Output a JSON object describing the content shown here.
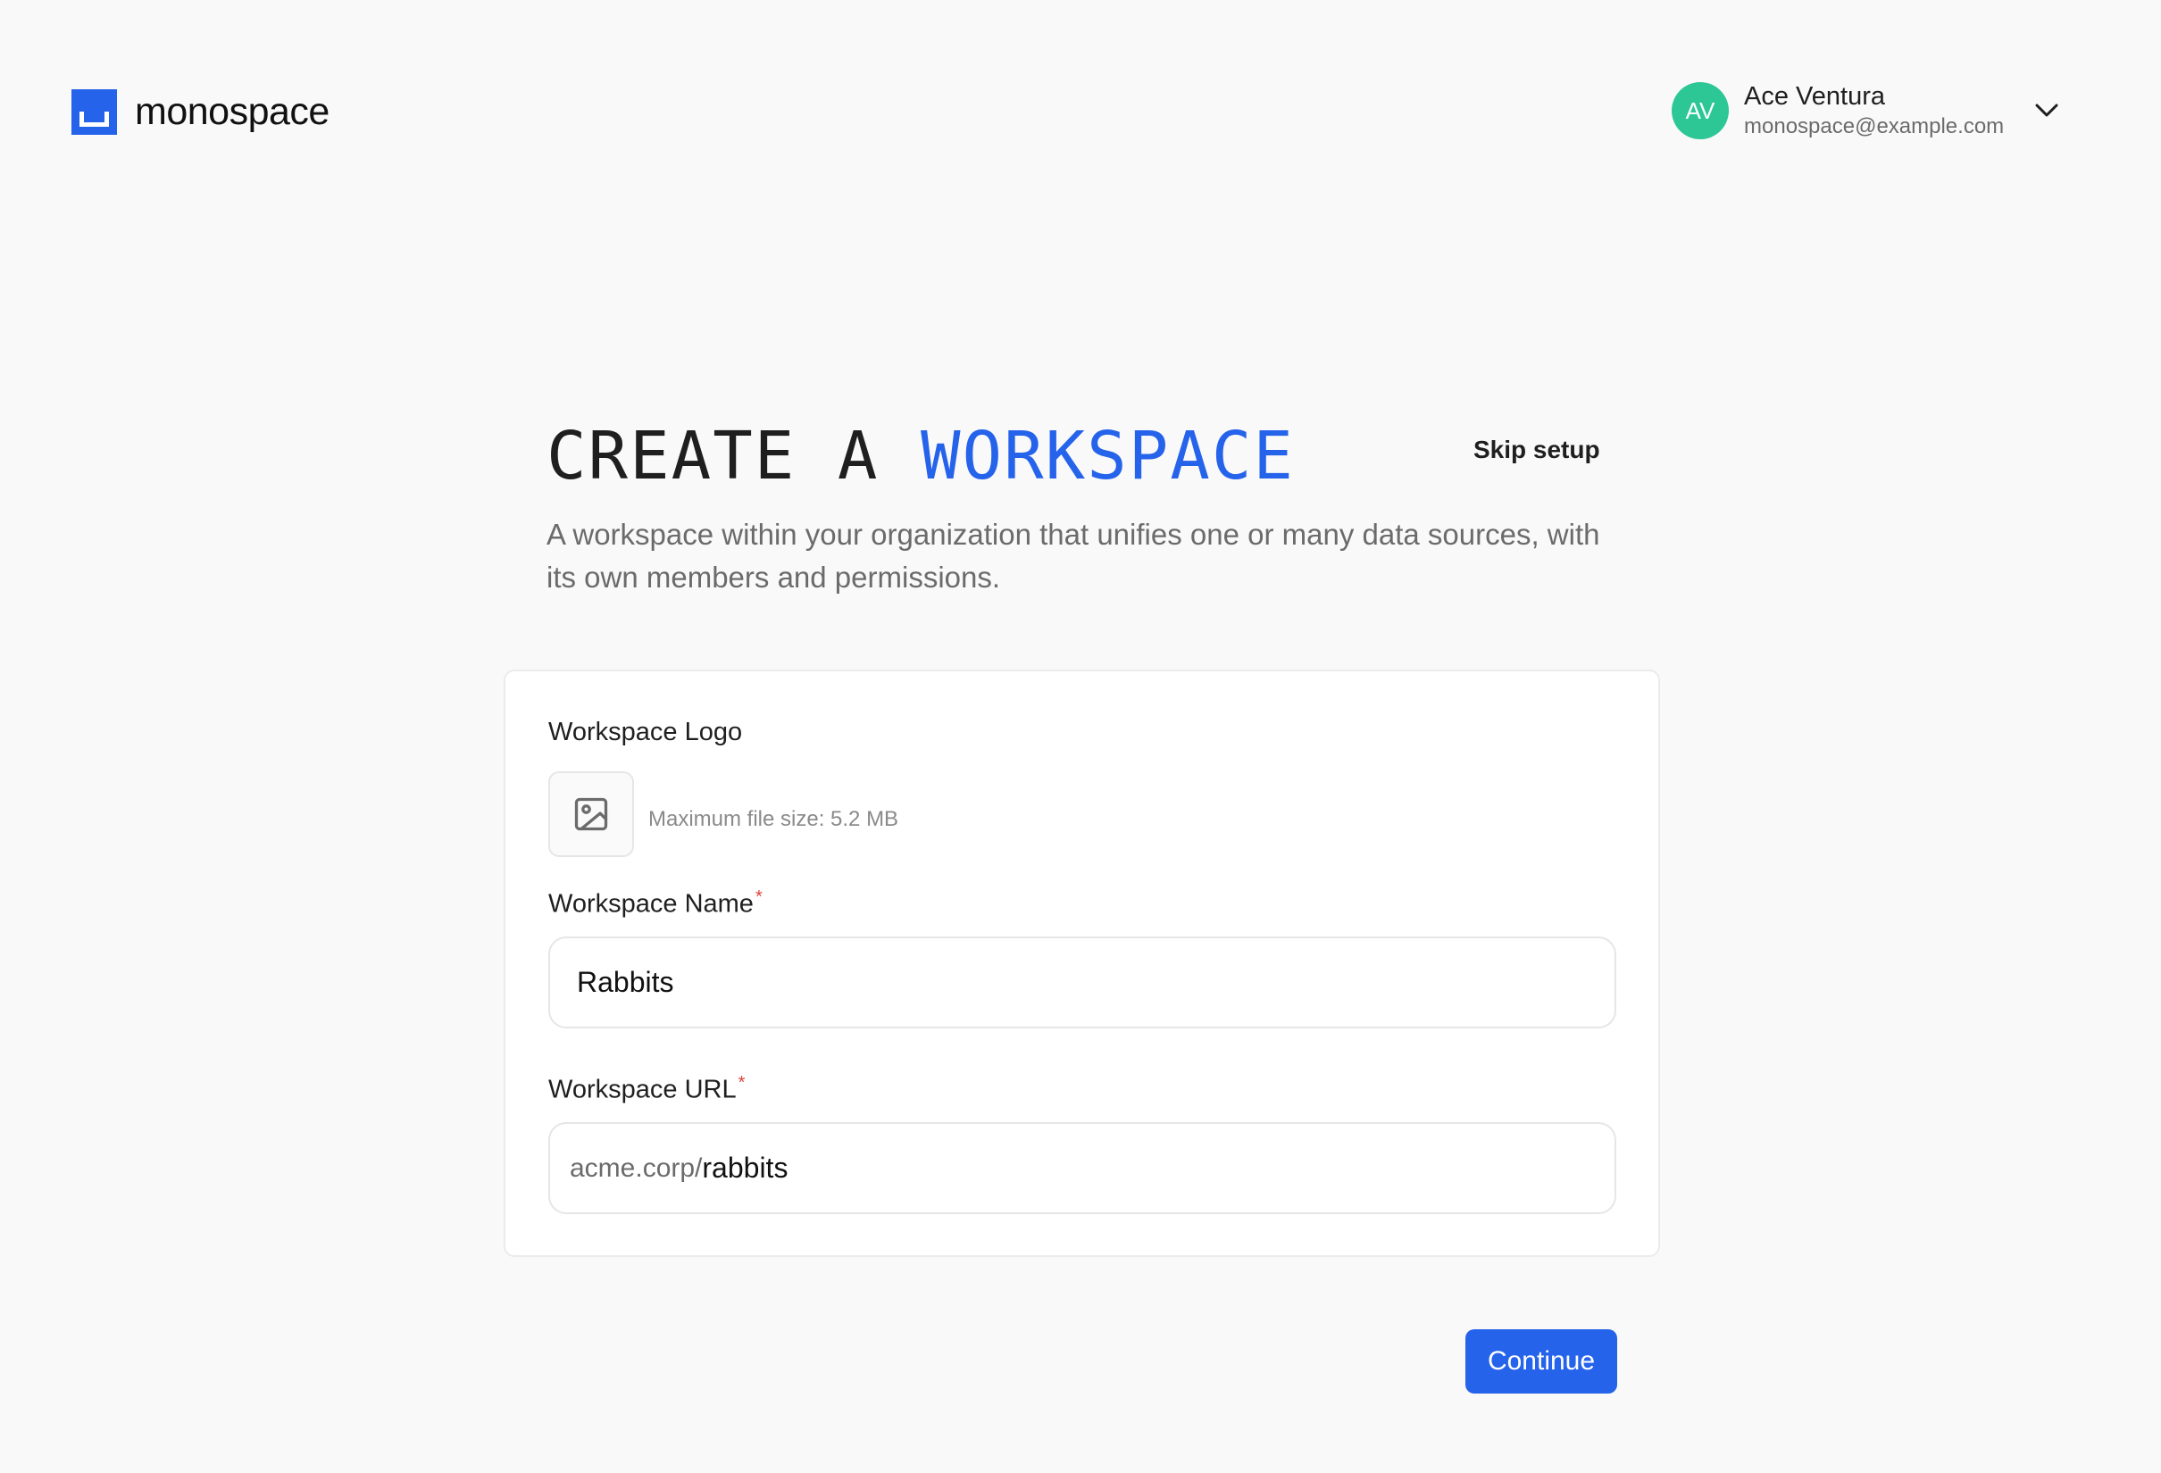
{
  "brand": {
    "name": "monospace",
    "color": "#2563eb"
  },
  "user": {
    "initials": "AV",
    "name": "Ace Ventura",
    "email": "monospace@example.com",
    "avatar_color": "#2cc795",
    "menu_icon": "chevron-down-icon"
  },
  "page": {
    "title_prefix": "CREATE A ",
    "title_accent": "WORKSPACE",
    "skip_label": "Skip setup",
    "subtitle": "A workspace within your organization that unifies one or many data sources, with its own members and permissions."
  },
  "form": {
    "logo": {
      "label": "Workspace Logo",
      "hint": "Maximum file size: 5.2 MB",
      "icon": "image-icon"
    },
    "name": {
      "label": "Workspace Name",
      "required_mark": "*",
      "value": "Rabbits"
    },
    "url": {
      "label": "Workspace URL",
      "required_mark": "*",
      "prefix": "acme.corp/",
      "value": "rabbits"
    }
  },
  "actions": {
    "continue_label": "Continue"
  },
  "colors": {
    "accent": "#2563eb",
    "required": "#e0413b",
    "background": "#f9f9f9"
  }
}
